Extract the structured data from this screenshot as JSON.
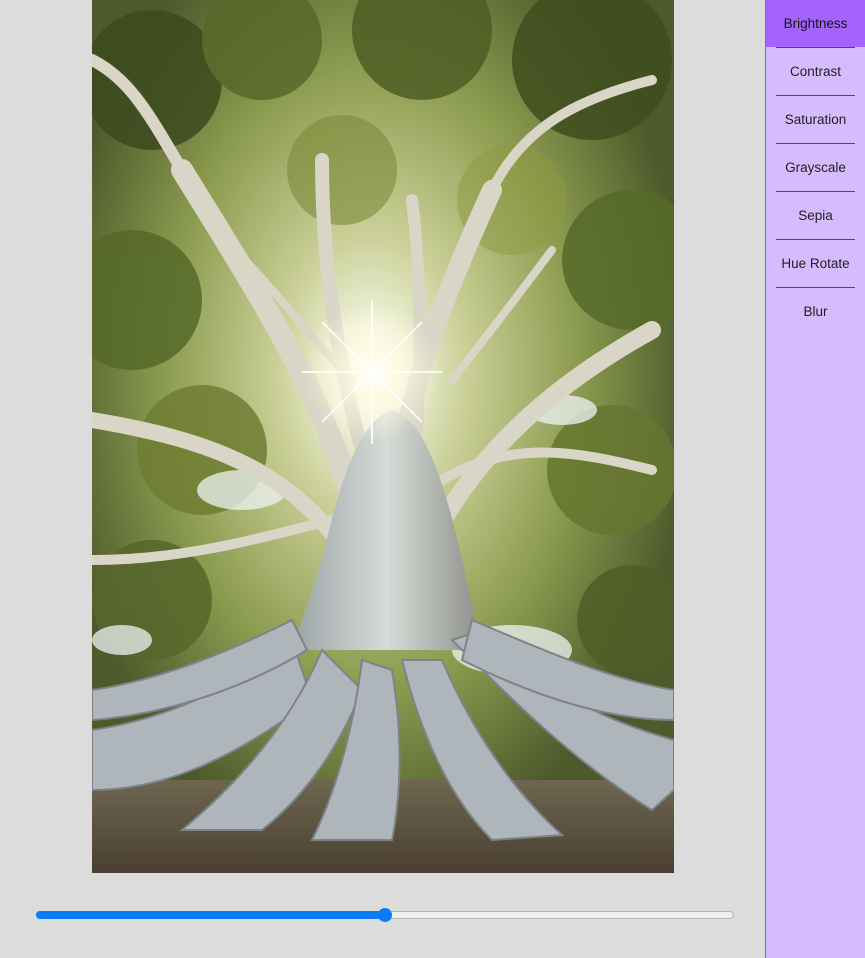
{
  "image": {
    "subject": "",
    "alt": ""
  },
  "slider": {
    "min": 0,
    "max": 200,
    "value": 100,
    "fill_color": "#0a7cf5"
  },
  "sidebar": {
    "background": "#d6bcff",
    "active_color": "#a463fb",
    "items": [
      {
        "label": "Brightness",
        "active": true
      },
      {
        "label": "Contrast",
        "active": false
      },
      {
        "label": "Saturation",
        "active": false
      },
      {
        "label": "Grayscale",
        "active": false
      },
      {
        "label": "Sepia",
        "active": false
      },
      {
        "label": "Hue Rotate",
        "active": false
      },
      {
        "label": "Blur",
        "active": false
      }
    ]
  }
}
